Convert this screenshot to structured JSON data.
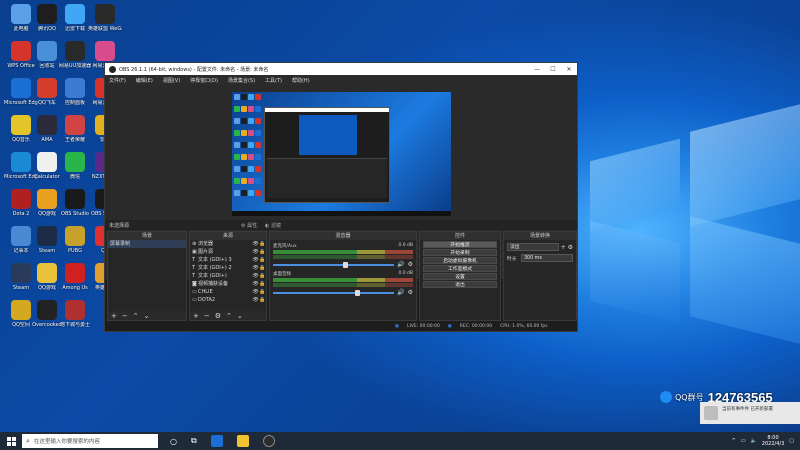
{
  "desktop": {
    "icons": [
      {
        "label": "此电脑",
        "color": "#5aa0e6"
      },
      {
        "label": "腾讯QQ",
        "color": "#1e1e1e"
      },
      {
        "label": "迅雷下载",
        "color": "#3fa7f5"
      },
      {
        "label": "英雄联盟 WeGame",
        "color": "#2a2a2a"
      },
      {
        "label": "WPS Office",
        "color": "#d4342c"
      },
      {
        "label": "回收站",
        "color": "#4a90d9"
      },
      {
        "label": "网易UU加速器",
        "color": "#2a2a2a"
      },
      {
        "label": "网易云音乐",
        "color": "#d94c8c"
      },
      {
        "label": "Microsoft Edge",
        "color": "#1b6fd4"
      },
      {
        "label": "QQ飞车",
        "color": "#d43c2c"
      },
      {
        "label": "控制面板",
        "color": "#3b7bd4"
      },
      {
        "label": "网易云音乐",
        "color": "#d8332a"
      },
      {
        "label": "QQ音乐",
        "color": "#e3c52a"
      },
      {
        "label": "AMA",
        "color": "#2a2a3a"
      },
      {
        "label": "王者荣耀",
        "color": "#d04444"
      },
      {
        "label": "饥荒",
        "color": "#e0b020"
      },
      {
        "label": "Microsoft Edge",
        "color": "#1b8ad4"
      },
      {
        "label": "Calculator",
        "color": "#f0f0f0"
      },
      {
        "label": "微信",
        "color": "#2ab54a"
      },
      {
        "label": "NZXT CAM",
        "color": "#5a2a8a"
      },
      {
        "label": "Dota 2",
        "color": "#b02020"
      },
      {
        "label": "QQ游戏",
        "color": "#e8a020"
      },
      {
        "label": "OBS Studio",
        "color": "#1a1a1a"
      },
      {
        "label": "OBS Studio",
        "color": "#1a1a1a"
      },
      {
        "label": "记事本",
        "color": "#4a8ad4"
      },
      {
        "label": "Steam",
        "color": "#1c2c44"
      },
      {
        "label": "PUBG",
        "color": "#c8a02c"
      },
      {
        "label": "QQ",
        "color": "#e03030"
      },
      {
        "label": "Steam",
        "color": "#2a3a5a"
      },
      {
        "label": "QQ游戏",
        "color": "#e8c23a"
      },
      {
        "label": "Among Us",
        "color": "#d02020"
      },
      {
        "label": "英雄联盟",
        "color": "#e0a030"
      },
      {
        "label": "QQ空间",
        "color": "#d4a820"
      },
      {
        "label": "Overcooked",
        "color": "#222222"
      },
      {
        "label": "地下城与勇士",
        "color": "#b03030"
      }
    ]
  },
  "obs": {
    "title": "OBS 26.1.1 (64-bit, windows) - 配置文件: 未命名 - 场景: 未命名",
    "window_controls": {
      "minimize": "—",
      "maximize": "☐",
      "close": "✕"
    },
    "menu": [
      "文件(F)",
      "编辑(E)",
      "视图(V)",
      "停靠窗口(D)",
      "场景集合(S)",
      "工具(T)",
      "帮助(H)"
    ],
    "scene_info": {
      "label": "未选择源",
      "properties": "⚙ 属性",
      "filters": "◐ 滤镜"
    },
    "docks": {
      "scenes": {
        "title": "场景",
        "items": [
          "屏幕录制"
        ]
      },
      "sources": {
        "title": "来源",
        "items": [
          "浏览器",
          "图片源",
          "文本 (GDI+) 3",
          "文本 (GDI+) 2",
          "文本 (GDI+)",
          "视频捕获设备",
          "CHLIE",
          "DOTA2"
        ]
      },
      "mixer": {
        "title": "混音器",
        "tracks": [
          {
            "name": "麦克风/Aux",
            "db": "0.0 dB"
          },
          {
            "name": "桌面音频",
            "db": "0.0 dB"
          }
        ]
      },
      "controls": {
        "title": "控件",
        "buttons": [
          "开始推流",
          "开始录制",
          "启动虚拟摄像机",
          "工作室模式",
          "设置",
          "退出"
        ]
      },
      "transitions": {
        "title": "场景转换",
        "type": "淡出",
        "duration_label": "时长",
        "duration": "300 ms"
      }
    },
    "statusbar": {
      "live": "LIVE: 00:00:00",
      "rec": "REC: 00:00:00",
      "cpu": "CPU: 1.0%, 60.00 fps"
    }
  },
  "notification": {
    "qq_label": "QQ群号",
    "qq_number": "124763565",
    "toast_text": "当前有事件件 已开新部署"
  },
  "taskbar": {
    "search_placeholder": "在这里输入你要搜索的内容",
    "time": "8:00",
    "date": "2022/4/3"
  }
}
